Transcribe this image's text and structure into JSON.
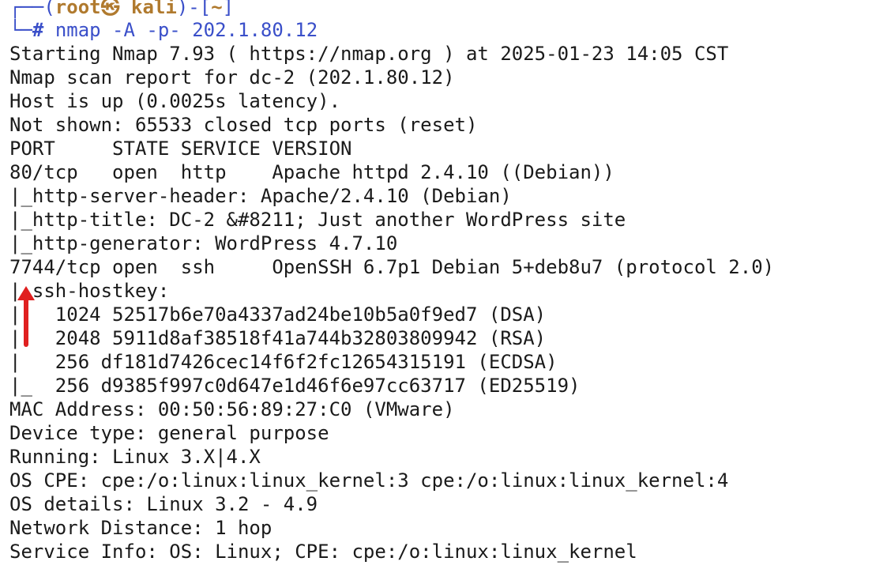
{
  "prompt": {
    "frame_top": "┌──(",
    "user_host": "root㉿ kali",
    "frame_mid": ")-[",
    "cwd": "~",
    "frame_end": "]",
    "frame_bottom": "└─",
    "hash": "#",
    "command": "nmap -A -p- 202.1.80.12"
  },
  "output_lines": [
    "Starting Nmap 7.93 ( https://nmap.org ) at 2025-01-23 14:05 CST",
    "Nmap scan report for dc-2 (202.1.80.12)",
    "Host is up (0.0025s latency).",
    "Not shown: 65533 closed tcp ports (reset)",
    "PORT     STATE SERVICE VERSION",
    "80/tcp   open  http    Apache httpd 2.4.10 ((Debian))",
    "|_http-server-header: Apache/2.4.10 (Debian)",
    "|_http-title: DC-2 &#8211; Just another WordPress site",
    "|_http-generator: WordPress 4.7.10",
    "7744/tcp open  ssh     OpenSSH 6.7p1 Debian 5+deb8u7 (protocol 2.0)",
    "| ssh-hostkey:",
    "|   1024 52517b6e70a4337ad24be10b5a0f9ed7 (DSA)",
    "|   2048 5911d8af38518f41a744b32803809942 (RSA)",
    "|   256 df181d7426cec14f6f2fc12654315191 (ECDSA)",
    "|_  256 d9385f997c0d647e1d46f6e97cc63717 (ED25519)",
    "MAC Address: 00:50:56:89:27:C0 (VMware)",
    "Device type: general purpose",
    "Running: Linux 3.X|4.X",
    "OS CPE: cpe:/o:linux:linux_kernel:3 cpe:/o:linux:linux_kernel:4",
    "OS details: Linux 3.2 - 4.9",
    "Network Distance: 1 hop",
    "Service Info: OS: Linux; CPE: cpe:/o:linux:linux_kernel"
  ],
  "colors": {
    "background": "#ffffff",
    "text": "#1a1a1a",
    "prompt_blue": "#3a4fc9",
    "prompt_user": "#b07a2e",
    "annotation_arrow": "#e02020"
  },
  "icons": {
    "annotation": "red-arrow-up-icon"
  }
}
